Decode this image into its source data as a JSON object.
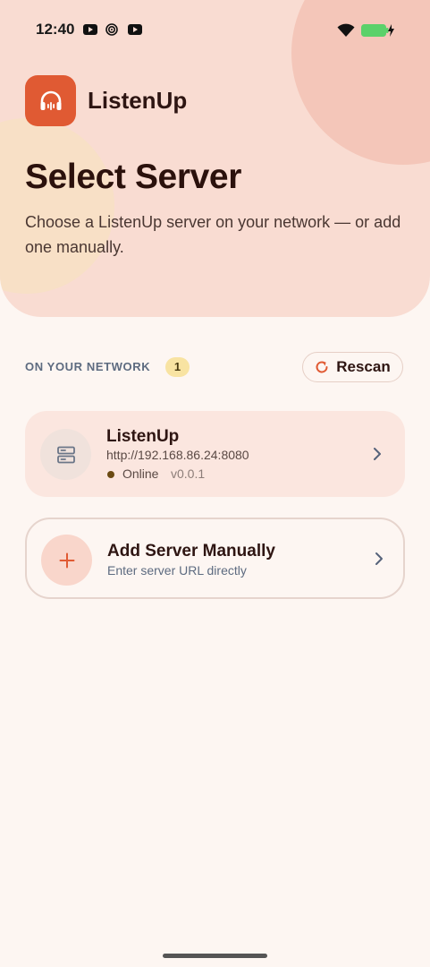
{
  "status_bar": {
    "time": "12:40",
    "icons": [
      "youtube-icon",
      "target-icon",
      "youtube-icon",
      "wifi-icon",
      "battery-charging-icon"
    ],
    "battery_color": "#5bd16a"
  },
  "header": {
    "app_name": "ListenUp",
    "logo_icon": "headphones-icon",
    "accent_color": "#e05a33",
    "title": "Select Server",
    "subtitle": "Choose a ListenUp server on your network — or add one manually."
  },
  "network": {
    "section_label": "ON YOUR NETWORK",
    "count": "1",
    "rescan_label": "Rescan",
    "servers": [
      {
        "name": "ListenUp",
        "url": "http://192.168.86.24:8080",
        "status": "Online",
        "version": "v0.0.1",
        "icon": "server-icon"
      }
    ]
  },
  "manual": {
    "title": "Add Server Manually",
    "subtitle": "Enter server URL directly",
    "icon": "plus-icon"
  }
}
